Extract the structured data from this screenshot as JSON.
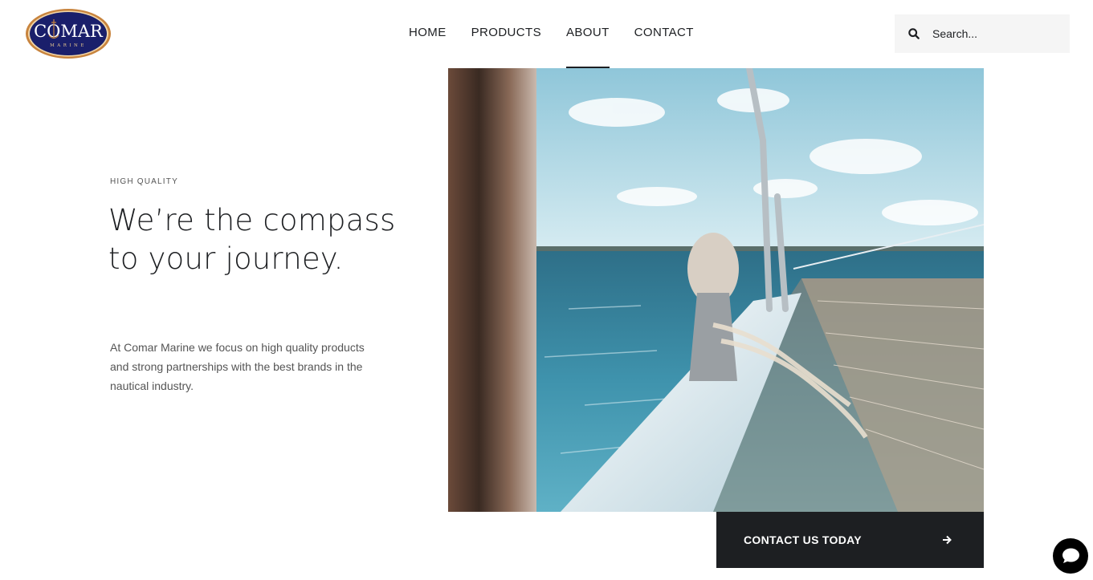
{
  "brand": {
    "logo_text": "COMAR",
    "logo_subtext": "MARINE",
    "logo_colors": {
      "fill": "#1a1f6b",
      "ring": "#c8843e",
      "text": "#ffffff"
    }
  },
  "nav": {
    "items": [
      {
        "label": "HOME"
      },
      {
        "label": "PRODUCTS"
      },
      {
        "label": "ABOUT",
        "active": true
      },
      {
        "label": "CONTACT"
      }
    ]
  },
  "search": {
    "placeholder": "Search...",
    "icon": "search-icon"
  },
  "hero": {
    "eyebrow": "HIGH QUALITY",
    "headline": "We’re the compass to your journey.",
    "body": "At Comar Marine we focus on high quality products and strong partnerships with the best brands in the nautical industry.",
    "image": "sailboat-bow-ocean-photo"
  },
  "cta": {
    "label": "CONTACT US TODAY",
    "icon": "arrow-right-icon"
  },
  "chat": {
    "icon": "chat-bubble-icon"
  },
  "colors": {
    "dark": "#1d1f22",
    "search_bg": "#f5f5f5",
    "body_text": "#555555"
  }
}
